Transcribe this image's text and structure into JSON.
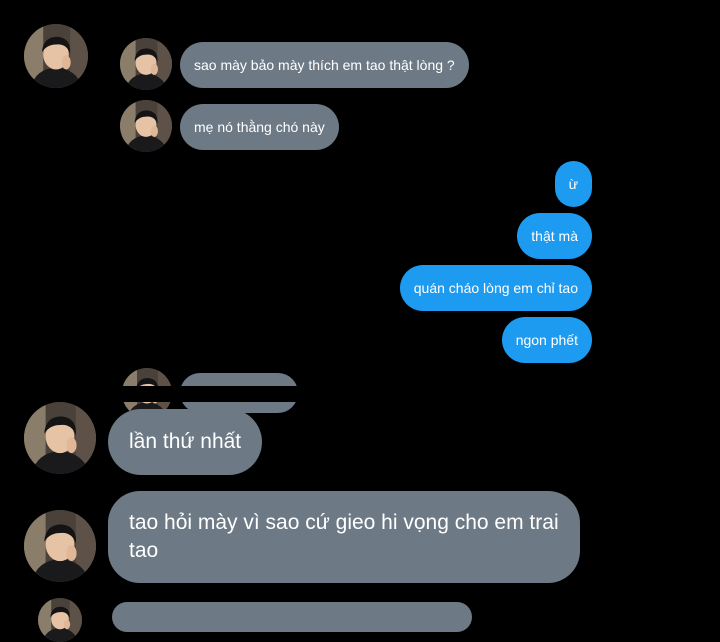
{
  "conversation": {
    "top_messages": [
      {
        "sender": "them",
        "text": "sao mày bảo mày thích em tao thật lòng ?"
      },
      {
        "sender": "them",
        "text": "mẹ nó thằng chó này"
      },
      {
        "sender": "me",
        "text": "ừ"
      },
      {
        "sender": "me",
        "text": "thật mà"
      },
      {
        "sender": "me",
        "text": "quán cháo lòng em chỉ tao"
      },
      {
        "sender": "me",
        "text": "ngon phết"
      }
    ],
    "bottom_messages": [
      {
        "sender": "them",
        "text": "lần thứ nhất"
      },
      {
        "sender": "them",
        "text": "tao hỏi mày vì sao cứ gieo hi vọng cho em trai tao"
      }
    ]
  },
  "colors": {
    "background": "#000000",
    "incoming_bubble": "#6d7985",
    "outgoing_bubble": "#1d9bf0",
    "text": "#ffffff"
  },
  "icons": {
    "avatar": "user-avatar-photo"
  }
}
